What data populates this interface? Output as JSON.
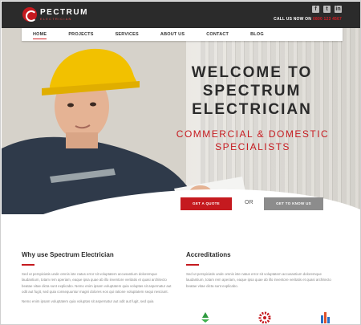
{
  "brand": {
    "name": "PECTRUM",
    "tagline": "ELECTRICIAN"
  },
  "social": [
    {
      "icon": "facebook-icon",
      "glyph": "f"
    },
    {
      "icon": "twitter-icon",
      "glyph": "t"
    },
    {
      "icon": "linkedin-icon",
      "glyph": "in"
    }
  ],
  "contact": {
    "label": "CALL US NOW ON",
    "phone": "0800 123 4567"
  },
  "nav": {
    "items": [
      "HOME",
      "PROJECTS",
      "SERVICES",
      "ABOUT US",
      "CONTACT",
      "BLOG"
    ],
    "active": "HOME"
  },
  "hero": {
    "title_line1": "WELCOME TO",
    "title_line2": "SPECTRUM",
    "title_line3": "ELECTRICIAN",
    "subtitle_line1": "COMMERCIAL & DOMESTIC",
    "subtitle_line2": "SPECIALISTS",
    "cta_primary": "GET A QUOTE",
    "or_label": "OR",
    "cta_secondary": "GET TO KNOW US"
  },
  "why": {
    "heading": "Why use Spectrum Electrician",
    "para1": "Sed ut perspiciatis unde omnis iste natus error sit voluptatem accusantium doloremque laudantium, totam rem aperiam, eaque ipsa quae ab illo inventore veritatis et quasi architecto beatae vitae dicta sunt explicabo. Nemo enim ipsam voluptatem quia voluptas sit aspernatur aut odit aut fugit, sed quia consequuntur magni dolores eos qui ratione voluptatem sequi nesciunt.",
    "para2": "Nemo enim ipsam voluptatem quia voluptas sit aspernatur aut odit aut fugit, sed quia"
  },
  "accreditations": {
    "heading": "Accreditations",
    "para1": "Sed ut perspiciatis unde omnis iste natus error sit voluptatem accusantium doloremque laudantium, totam rem aperiam, eaque ipsa quae ab illo inventore veritatis et quasi architecto beatae vitae dicta sunt explicabo.",
    "logos": [
      "recycle-logo-icon",
      "gear-logo-icon",
      "bar-logo-icon"
    ]
  },
  "colors": {
    "accent": "#c51a1f",
    "dark": "#2b2b2b",
    "button_grey": "#8c8c8c"
  }
}
